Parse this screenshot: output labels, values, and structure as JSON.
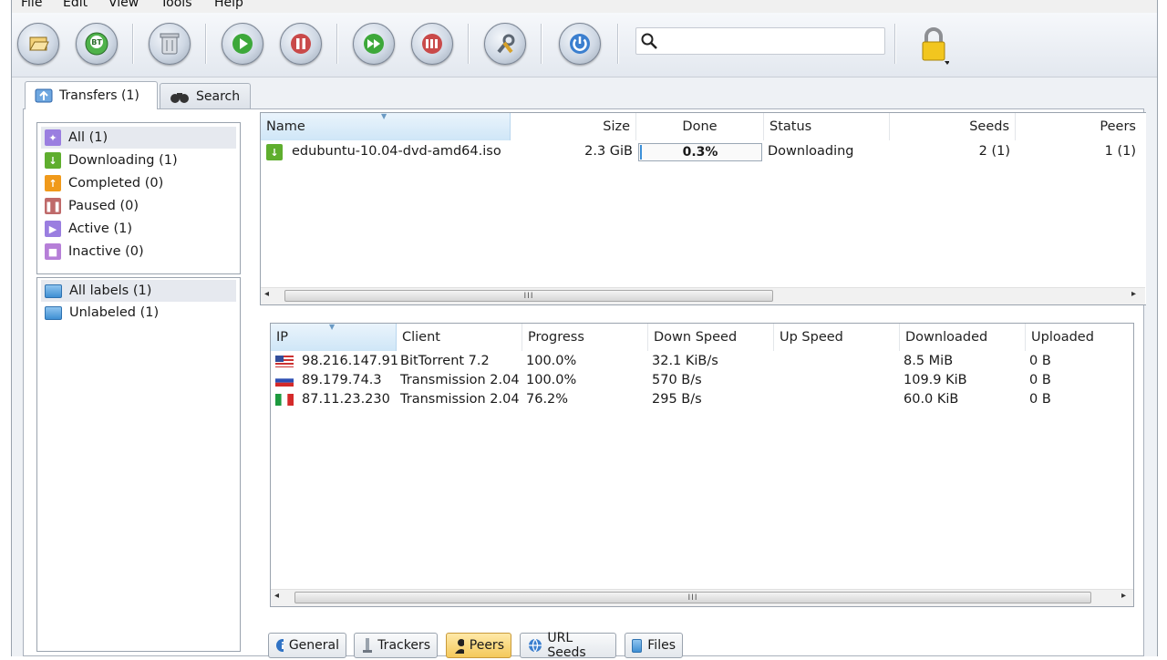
{
  "menu": [
    "File",
    "Edit",
    "View",
    "Tools",
    "Help"
  ],
  "toolbar": {
    "search_placeholder": "",
    "badge_bt": "BT"
  },
  "tabs": [
    {
      "label": "Transfers (1)",
      "icon": "transfers-icon"
    },
    {
      "label": "Search",
      "icon": "binoculars-icon"
    }
  ],
  "filters": [
    {
      "label": "All (1)",
      "icon": "all-icon",
      "color": "#9a7ee0"
    },
    {
      "label": "Downloading (1)",
      "icon": "download-arrow-icon",
      "color": "#5fae2e"
    },
    {
      "label": "Completed (0)",
      "icon": "upload-arrow-icon",
      "color": "#f09a1b"
    },
    {
      "label": "Paused (0)",
      "icon": "pause-icon",
      "color": "#bf6a6a"
    },
    {
      "label": "Active (1)",
      "icon": "play-icon",
      "color": "#9a7ee0"
    },
    {
      "label": "Inactive (0)",
      "icon": "stop-icon",
      "color": "#b67fd8"
    }
  ],
  "labels": [
    {
      "label": "All labels (1)"
    },
    {
      "label": "Unlabeled (1)"
    }
  ],
  "transfers": {
    "columns": [
      "Name",
      "Size",
      "Done",
      "Status",
      "Seeds",
      "Peers"
    ],
    "rows": [
      {
        "name": "edubuntu-10.04-dvd-amd64.iso",
        "size": "2.3 GiB",
        "done": "0.3%",
        "done_fraction": 0.003,
        "status": "Downloading",
        "seeds": "2 (1)",
        "peers": "1 (1)"
      }
    ]
  },
  "peers": {
    "columns": [
      "IP",
      "Client",
      "Progress",
      "Down Speed",
      "Up Speed",
      "Downloaded",
      "Uploaded"
    ],
    "rows": [
      {
        "flag": "us-flag-icon",
        "ip": "98.216.147.91",
        "client": "BitTorrent 7.2",
        "progress": "100.0%",
        "down": "32.1 KiB/s",
        "up": "",
        "downloaded": "8.5 MiB",
        "uploaded": "0 B"
      },
      {
        "flag": "ru-flag-icon",
        "ip": "89.179.74.3",
        "client": "Transmission 2.04",
        "progress": "100.0%",
        "down": "570 B/s",
        "up": "",
        "downloaded": "109.9 KiB",
        "uploaded": "0 B"
      },
      {
        "flag": "it-flag-icon",
        "ip": "87.11.23.230",
        "client": "Transmission 2.04",
        "progress": "76.2%",
        "down": "295 B/s",
        "up": "",
        "downloaded": "60.0 KiB",
        "uploaded": "0 B"
      }
    ]
  },
  "bottom_tabs": [
    {
      "label": "General",
      "icon": "info-icon"
    },
    {
      "label": "Trackers",
      "icon": "tracker-icon"
    },
    {
      "label": "Peers",
      "icon": "peers-icon",
      "active": true
    },
    {
      "label": "URL Seeds",
      "icon": "url-seeds-icon"
    },
    {
      "label": "Files",
      "icon": "files-icon"
    }
  ],
  "colors": {
    "progress_fill": "#3c8fd8",
    "selected_header": "#d6eaf8",
    "active_tab": "#f4c95b"
  }
}
